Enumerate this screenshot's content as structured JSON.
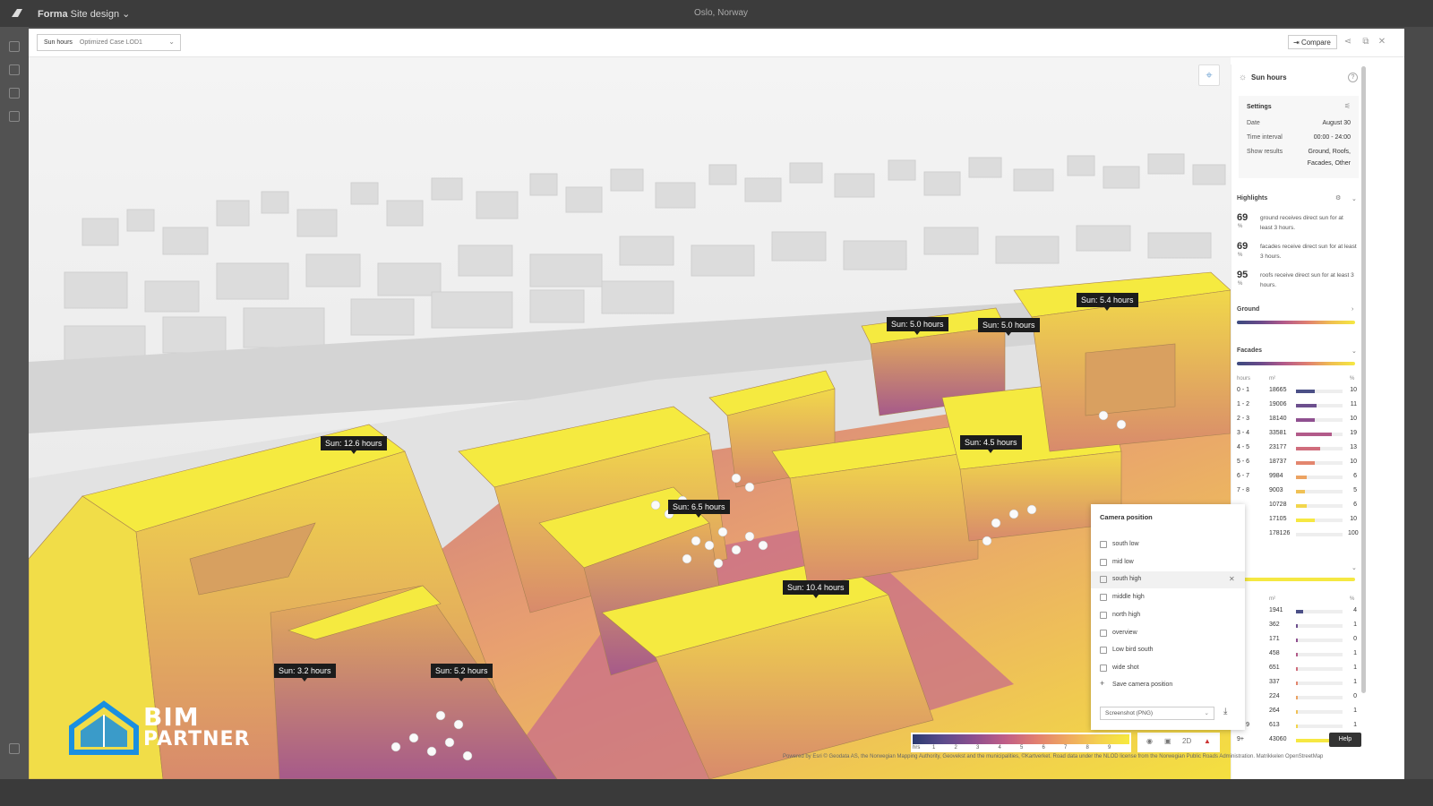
{
  "topbar": {
    "app_brand": "Forma",
    "app_title": " Site design",
    "location": "Oslo, Norway"
  },
  "header": {
    "analysis": "Sun hours",
    "scenario": "Optimized Case LOD1",
    "compare_label": "Compare"
  },
  "scene": {
    "labels": [
      {
        "text": "Sun: 12.6 hours"
      },
      {
        "text": "Sun: 5.0 hours"
      },
      {
        "text": "Sun: 5.0 hours"
      },
      {
        "text": "Sun: 5.4 hours"
      },
      {
        "text": "Sun: 4.5 hours"
      },
      {
        "text": "Sun: 6.5 hours"
      },
      {
        "text": "Sun: 10.4 hours"
      },
      {
        "text": "Sun: 3.2 hours"
      },
      {
        "text": "Sun: 5.2 hours"
      }
    ]
  },
  "panel": {
    "title": "Sun hours",
    "settings": {
      "title": "Settings",
      "date_label": "Date",
      "date_value": "August 30",
      "interval_label": "Time interval",
      "interval_value": "00:00 - 24:00",
      "show_label": "Show results",
      "show_value_1": "Ground, Roofs,",
      "show_value_2": "Facades, Other"
    },
    "highlights": {
      "title": "Highlights",
      "items": [
        {
          "value": "69",
          "unit": "%",
          "text": "ground receives direct sun for at least 3 hours."
        },
        {
          "value": "69",
          "unit": "%",
          "text": "facades receive direct sun for at least 3 hours."
        },
        {
          "value": "95",
          "unit": "%",
          "text": "roofs receive direct sun for at least 3 hours."
        }
      ]
    },
    "ground_label": "Ground",
    "facades_label": "Facades",
    "roofs_label": "fs",
    "table_headers": {
      "hours": "hours",
      "area": "m²",
      "pct": "%"
    },
    "facades_rows": [
      {
        "range": "0 - 1",
        "area": "18665",
        "pct": "10",
        "frac": 0.1,
        "color": "#4b4f86"
      },
      {
        "range": "1 - 2",
        "area": "19006",
        "pct": "11",
        "frac": 0.11,
        "color": "#6c4f8e"
      },
      {
        "range": "2 - 3",
        "area": "18140",
        "pct": "10",
        "frac": 0.1,
        "color": "#8f5090"
      },
      {
        "range": "3 - 4",
        "area": "33581",
        "pct": "19",
        "frac": 0.19,
        "color": "#b25b8a"
      },
      {
        "range": "4 - 5",
        "area": "23177",
        "pct": "13",
        "frac": 0.13,
        "color": "#d06d7c"
      },
      {
        "range": "5 - 6",
        "area": "18737",
        "pct": "10",
        "frac": 0.1,
        "color": "#e3866e"
      },
      {
        "range": "6 - 7",
        "area": "9984",
        "pct": "6",
        "frac": 0.06,
        "color": "#eca362"
      },
      {
        "range": "7 - 8",
        "area": "9003",
        "pct": "5",
        "frac": 0.05,
        "color": "#f0c155"
      },
      {
        "range": "",
        "area": "10728",
        "pct": "6",
        "frac": 0.06,
        "color": "#f2d64c"
      },
      {
        "range": "",
        "area": "17105",
        "pct": "10",
        "frac": 0.1,
        "color": "#f6e842"
      },
      {
        "range": "al",
        "area": "178126",
        "pct": "100",
        "frac": 0,
        "color": "#ffffff"
      }
    ],
    "roofs_headers": {
      "hours": "rs",
      "area": "m²",
      "pct": "%"
    },
    "roofs_rows": [
      {
        "range": "1",
        "area": "1941",
        "pct": "4",
        "frac": 0.04,
        "color": "#4b4f86"
      },
      {
        "range": "2",
        "area": "362",
        "pct": "1",
        "frac": 0.01,
        "color": "#6c4f8e"
      },
      {
        "range": "3",
        "area": "171",
        "pct": "0",
        "frac": 0.005,
        "color": "#8f5090"
      },
      {
        "range": "4",
        "area": "458",
        "pct": "1",
        "frac": 0.01,
        "color": "#b25b8a"
      },
      {
        "range": "5",
        "area": "651",
        "pct": "1",
        "frac": 0.01,
        "color": "#d06d7c"
      },
      {
        "range": "6",
        "area": "337",
        "pct": "1",
        "frac": 0.01,
        "color": "#e3866e"
      },
      {
        "range": "7",
        "area": "224",
        "pct": "0",
        "frac": 0.005,
        "color": "#eca362"
      },
      {
        "range": "8",
        "area": "264",
        "pct": "1",
        "frac": 0.01,
        "color": "#f0c155"
      },
      {
        "range": "8 - 9",
        "area": "613",
        "pct": "1",
        "frac": 0.01,
        "color": "#f2d64c"
      },
      {
        "range": "9+",
        "area": "43060",
        "pct": "",
        "frac": 0.9,
        "color": "#f6e842"
      }
    ]
  },
  "camera": {
    "title": "Camera position",
    "items": [
      {
        "label": "south low"
      },
      {
        "label": "mid low"
      },
      {
        "label": "south high"
      },
      {
        "label": "middle high"
      },
      {
        "label": "north high"
      },
      {
        "label": "overview"
      },
      {
        "label": "Low bird south"
      },
      {
        "label": "wide shot"
      }
    ],
    "save_label": "Save camera position",
    "screenshot_label": "Screenshot (PNG)"
  },
  "legend": {
    "unit": "hrs",
    "ticks": [
      "1",
      "2",
      "3",
      "4",
      "5",
      "6",
      "7",
      "8",
      "9"
    ]
  },
  "view_toggle": "2D",
  "help_label": "Help",
  "attribution": "Powered by Esri © Geodata AS, the Norwegian Mapping Authority, Geovekst and the municipalities, ©Kartverket. Road data under the NLOD license from the Norwegian Public Roads Administration. Matrikkelen OpenStreetMap",
  "logo": {
    "line1": "BIM",
    "line2": "PARTNER"
  },
  "colors": {
    "accent": "#f5e842",
    "shadow": "#b35a8a",
    "deep": "#3b4a7e"
  }
}
